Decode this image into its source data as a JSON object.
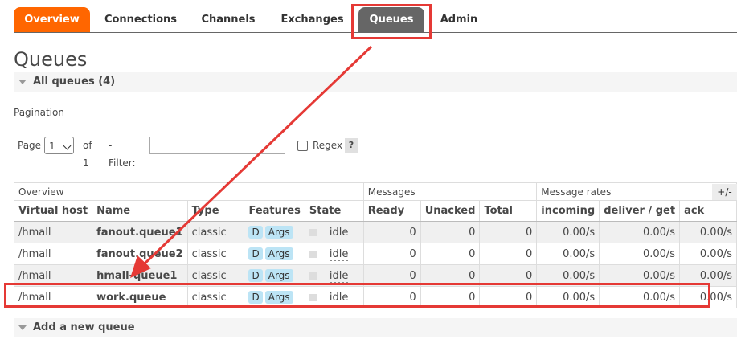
{
  "nav": {
    "tabs": [
      {
        "label": "Overview"
      },
      {
        "label": "Connections"
      },
      {
        "label": "Channels"
      },
      {
        "label": "Exchanges"
      },
      {
        "label": "Queues"
      },
      {
        "label": "Admin"
      }
    ]
  },
  "page_title": "Queues",
  "all_queues_label": "All queues (4)",
  "pagination": {
    "label": "Pagination",
    "page_label": "Page",
    "page_value": "1",
    "of_label": "of 1",
    "filter_label": "- Filter:",
    "filter_value": "",
    "regex_label": "Regex",
    "help_label": "?"
  },
  "table": {
    "groups": [
      "Overview",
      "Messages",
      "Message rates"
    ],
    "columns": [
      "Virtual host",
      "Name",
      "Type",
      "Features",
      "State",
      "Ready",
      "Unacked",
      "Total",
      "incoming",
      "deliver / get",
      "ack"
    ],
    "plus_minus": "+/-",
    "rows": [
      {
        "vhost": "/hmall",
        "name": "fanout.queue1",
        "type": "classic",
        "f1": "D",
        "f2": "Args",
        "state": "idle",
        "ready": "0",
        "unacked": "0",
        "total": "0",
        "incoming": "0.00/s",
        "deliver": "0.00/s",
        "ack": "0.00/s"
      },
      {
        "vhost": "/hmall",
        "name": "fanout.queue2",
        "type": "classic",
        "f1": "D",
        "f2": "Args",
        "state": "idle",
        "ready": "0",
        "unacked": "0",
        "total": "0",
        "incoming": "0.00/s",
        "deliver": "0.00/s",
        "ack": "0.00/s"
      },
      {
        "vhost": "/hmall",
        "name": "hmall-queue1",
        "type": "classic",
        "f1": "D",
        "f2": "Args",
        "state": "idle",
        "ready": "0",
        "unacked": "0",
        "total": "0",
        "incoming": "0.00/s",
        "deliver": "0.00/s",
        "ack": "0.00/s"
      },
      {
        "vhost": "/hmall",
        "name": "work.queue",
        "type": "classic",
        "f1": "D",
        "f2": "Args",
        "state": "idle",
        "ready": "0",
        "unacked": "0",
        "total": "0",
        "incoming": "0.00/s",
        "deliver": "0.00/s",
        "ack": "0.00/s"
      }
    ]
  },
  "add_queue_label": "Add a new queue",
  "colors": {
    "accent_orange": "#ff6600",
    "tab_grey": "#666666",
    "annotation_red": "#e53935",
    "feature_badge": "#bce4f5"
  }
}
